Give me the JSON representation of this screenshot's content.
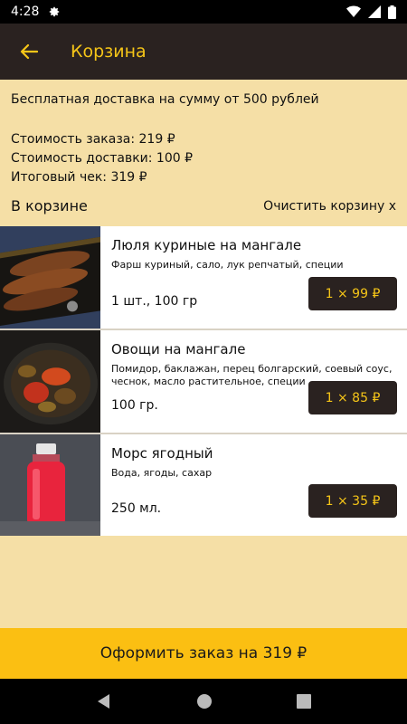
{
  "status_bar": {
    "time": "4:28"
  },
  "header": {
    "title": "Корзина"
  },
  "delivery": {
    "free_delivery_text": "Бесплатная доставка на сумму от 500 рублей"
  },
  "summary": {
    "order_cost": "Стоимость заказа: 219 ₽",
    "delivery_cost": "Стоимость доставки: 100 ₽",
    "total": "Итоговый чек: 319 ₽"
  },
  "cart": {
    "section_title": "В корзине",
    "clear_label": "Очистить корзину х",
    "items": [
      {
        "name": "Люля куриные на мангале",
        "description": "Фарш куриный, сало, лук репчатый, специи",
        "quantity": "1 шт., 100 гр",
        "price": "1 × 99 ₽"
      },
      {
        "name": "Овощи на мангале",
        "description": "Помидор, баклажан, перец болгарский, соевый соус, чеснок, масло растительное, специи",
        "quantity": "100 гр.",
        "price": "1 × 85 ₽"
      },
      {
        "name": "Морс ягодный",
        "description": "Вода, ягоды, сахар",
        "quantity": "250 мл.",
        "price": "1 × 35 ₽"
      }
    ]
  },
  "checkout": {
    "label": "Оформить заказ на 319 ₽"
  },
  "colors": {
    "accent": "#f5c518",
    "header_bg": "#2a2220",
    "page_bg": "#f5dfa6",
    "checkout_bg": "#fbbf12"
  }
}
